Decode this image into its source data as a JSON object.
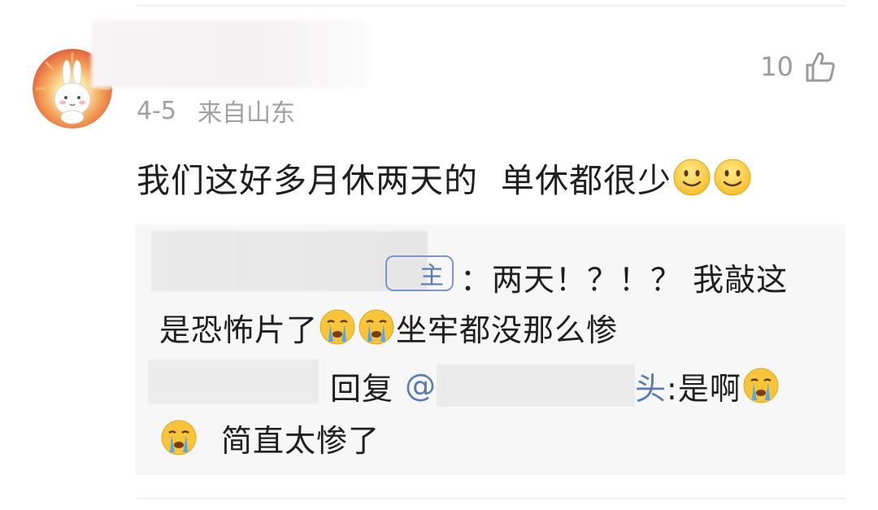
{
  "comment": {
    "date": "4-5",
    "location": "来自山东",
    "likes": "10",
    "text_part1": "我们这好多月休两天的",
    "text_part2": "单休都很少",
    "emoji_name": "slight-smile-emoji"
  },
  "replies": [
    {
      "author_tag": "主",
      "line1": "：两天！？！？ 我敲这",
      "line2_part1": "是恐怖片了",
      "line2_part2": "坐牢都没那么惨",
      "emoji_name": "crying-face-emoji"
    },
    {
      "reply_word": "回复",
      "mention_prefix": "@",
      "mention_suffix": "头",
      "text_part1": ":是啊",
      "text_part2": "简直太惨了",
      "emoji_name": "crying-face-emoji"
    }
  ],
  "colors": {
    "link": "#5a7bb5",
    "meta": "#a1a1a1",
    "text": "#1f1f1f",
    "reply_bg": "#f7f7f7"
  }
}
